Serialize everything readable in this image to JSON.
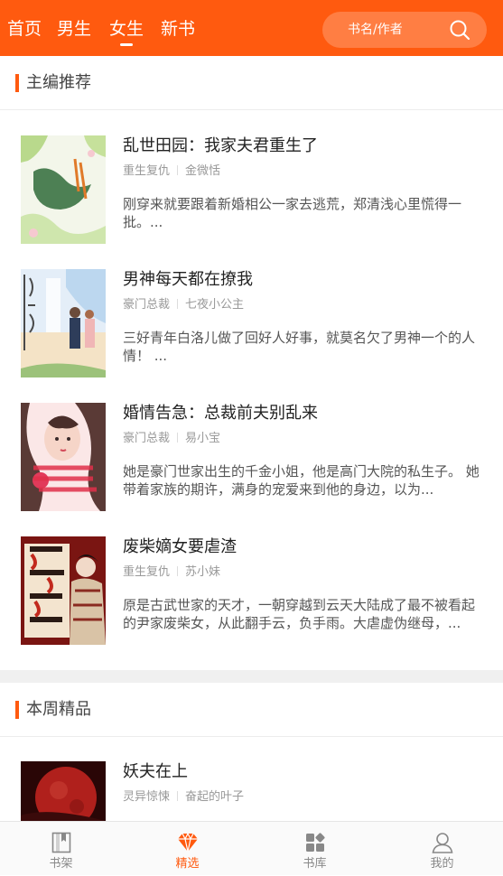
{
  "header": {
    "tabs": [
      {
        "label": "首页",
        "active": false
      },
      {
        "label": "男生",
        "active": false
      },
      {
        "label": "女生",
        "active": true
      },
      {
        "label": "新书",
        "active": false
      }
    ],
    "search_placeholder": "书名/作者",
    "search_icon": "search-icon",
    "accent_color": "#ff5a0f"
  },
  "sections": [
    {
      "title": "主编推荐",
      "books": [
        {
          "title": "乱世田园：我家夫君重生了",
          "category": "重生复仇",
          "author": "金微恬",
          "desc": "刚穿来就要跟着新婚相公一家去逃荒，郑清浅心里慌得一批。..."
        },
        {
          "title": "男神每天都在撩我",
          "category": "豪门总裁",
          "author": "七夜小公主",
          "desc": "三好青年白洛儿做了回好人好事，就莫名欠了男神一个的人情！ ..."
        },
        {
          "title": "婚情告急：总裁前夫别乱来",
          "category": "豪门总裁",
          "author": "易小宝",
          "desc": "她是豪门世家出生的千金小姐，他是高门大院的私生子。 她带着家族的期许，满身的宠爱来到他的身边，以为..."
        },
        {
          "title": "废柴嫡女要虐渣",
          "category": "重生复仇",
          "author": "苏小妹",
          "desc": "原是古武世家的天才，一朝穿越到云天大陆成了最不被看起的尹家废柴女，从此翻手云，负手雨。大虐虚伪继母，..."
        }
      ]
    },
    {
      "title": "本周精品",
      "books": [
        {
          "title": "妖夫在上",
          "category": "灵异惊悚",
          "author": "奋起的叶子",
          "desc": ""
        }
      ]
    }
  ],
  "tabbar": [
    {
      "label": "书架",
      "icon": "bookshelf-icon",
      "active": false
    },
    {
      "label": "精选",
      "icon": "diamond-icon",
      "active": true
    },
    {
      "label": "书库",
      "icon": "library-grid-icon",
      "active": false
    },
    {
      "label": "我的",
      "icon": "user-icon",
      "active": false
    }
  ]
}
